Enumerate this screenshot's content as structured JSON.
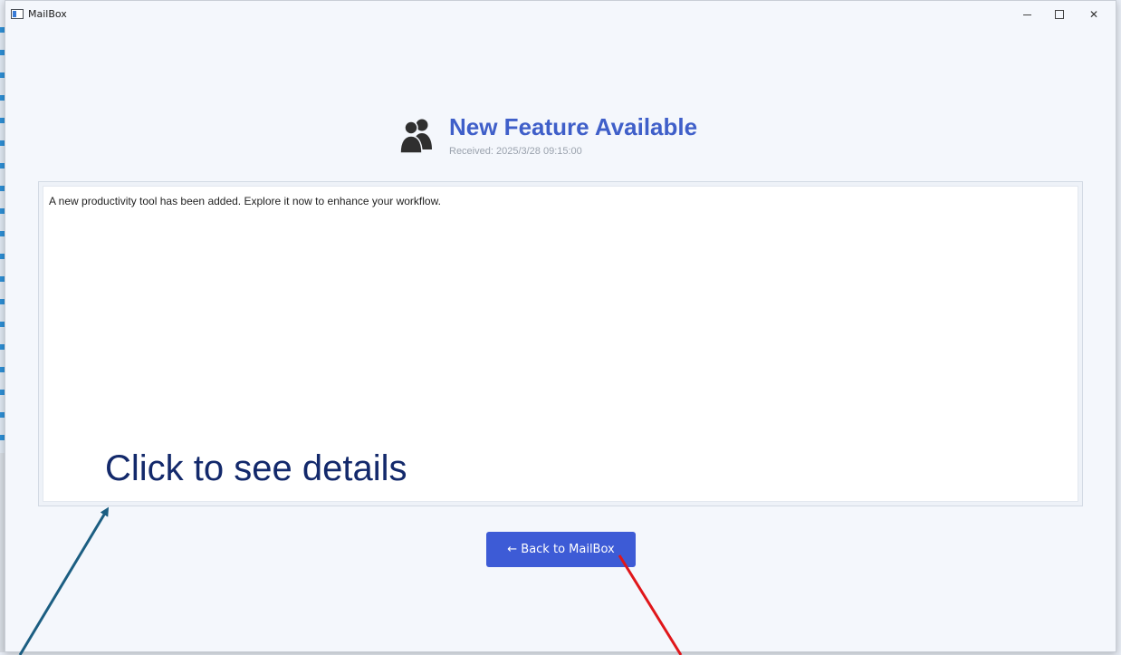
{
  "window": {
    "title": "MailBox",
    "controls": {
      "minimize": "–",
      "maximize": "□",
      "close": "✕"
    }
  },
  "message": {
    "icon": "people-icon",
    "title": "New Feature Available",
    "received": "Received: 2025/3/28 09:15:00",
    "body": "A new productivity tool has been added. Explore it now to enhance your workflow."
  },
  "actions": {
    "back_label": "← Back to MailBox"
  },
  "annotation": {
    "text": "Click to see details"
  },
  "colors": {
    "accent": "#3d5bd6",
    "title": "#3f5fc9",
    "annotation_text": "#13296b",
    "arrow_blue": "#1b5e82",
    "arrow_red": "#e0161a"
  }
}
